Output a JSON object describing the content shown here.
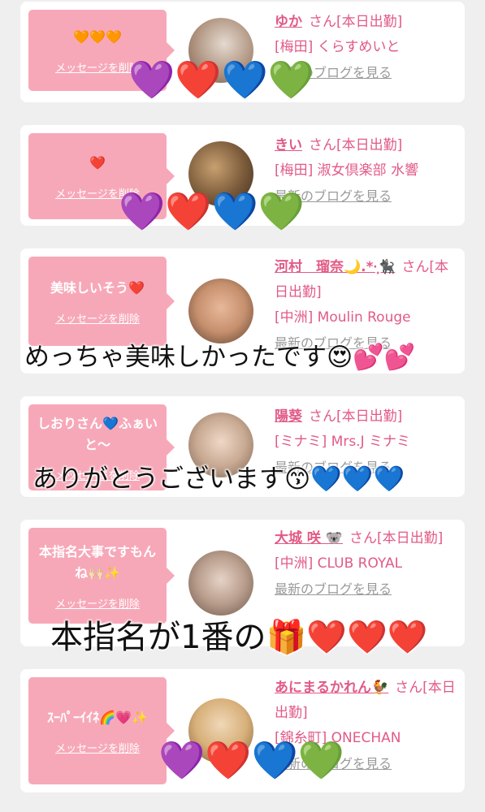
{
  "cards": [
    {
      "message": "🧡🧡🧡",
      "delete_label": "メッセージを削除",
      "name": "ゆか",
      "san": "さん[本日出勤]",
      "shop": "[梅田] くらすめいと",
      "blog": "最新のブログを見る",
      "avatar_color": "#b09480"
    },
    {
      "message": "❤️",
      "delete_label": "メッセージを削除",
      "name": "きい",
      "san": "さん[本日出勤]",
      "shop": "[梅田] 淑女倶楽部 水響",
      "blog": "最新のブログを見る",
      "avatar_color": "#8a6a45"
    },
    {
      "message": "美味しいそう❤️",
      "delete_label": "メッセージを削除",
      "name": "河村　瑠奈🌙.*·̩͙🐈‍⬛",
      "san": "さん[本日出勤]",
      "shop": "[中洲] Moulin Rouge",
      "blog": "最新のブログを見る",
      "avatar_color": "#c6906e"
    },
    {
      "message": "しおりさん💙ふぁいと〜",
      "delete_label": "メッセージを削除",
      "name": "陽葵",
      "san": "さん[本日出勤]",
      "shop": "[ミナミ] Mrs.J ミナミ",
      "blog": "最新のブログを見る",
      "avatar_color": "#c9aa93"
    },
    {
      "message": "本指名大事ですもんね🙌🏻✨",
      "delete_label": "メッセージを削除",
      "name": "大城 咲 🐨",
      "san": "さん[本日出勤]",
      "shop": "[中洲] CLUB ROYAL",
      "blog": "最新のブログを見る",
      "avatar_color": "#b89d8c"
    },
    {
      "message": "ｽｰﾊﾟｰｲｲﾈ🌈💗✨",
      "delete_label": "メッセージを削除",
      "name": "あにまるかれん🐓",
      "san": "さん[本日出勤]",
      "shop": "[錦糸町] ONECHAN",
      "blog": "最新のブログを見る",
      "avatar_color": "#d8b07a"
    }
  ],
  "overlays": {
    "hearts_1": "💜❤️💙💚",
    "hearts_2": "💜❤️💙💚",
    "text_3": "めっちゃ美味しかったです😍💕💕",
    "text_4": "ありがとうございます😙💙💙💙",
    "text_5": "本指名が1番の🎁❤️❤️❤️",
    "hearts_6": "💜❤️💙💚"
  },
  "colors": {
    "background": "#efefef",
    "bubble": "#f7a8b8",
    "accent": "#e25a86",
    "link_gray": "#9a9a9a"
  }
}
